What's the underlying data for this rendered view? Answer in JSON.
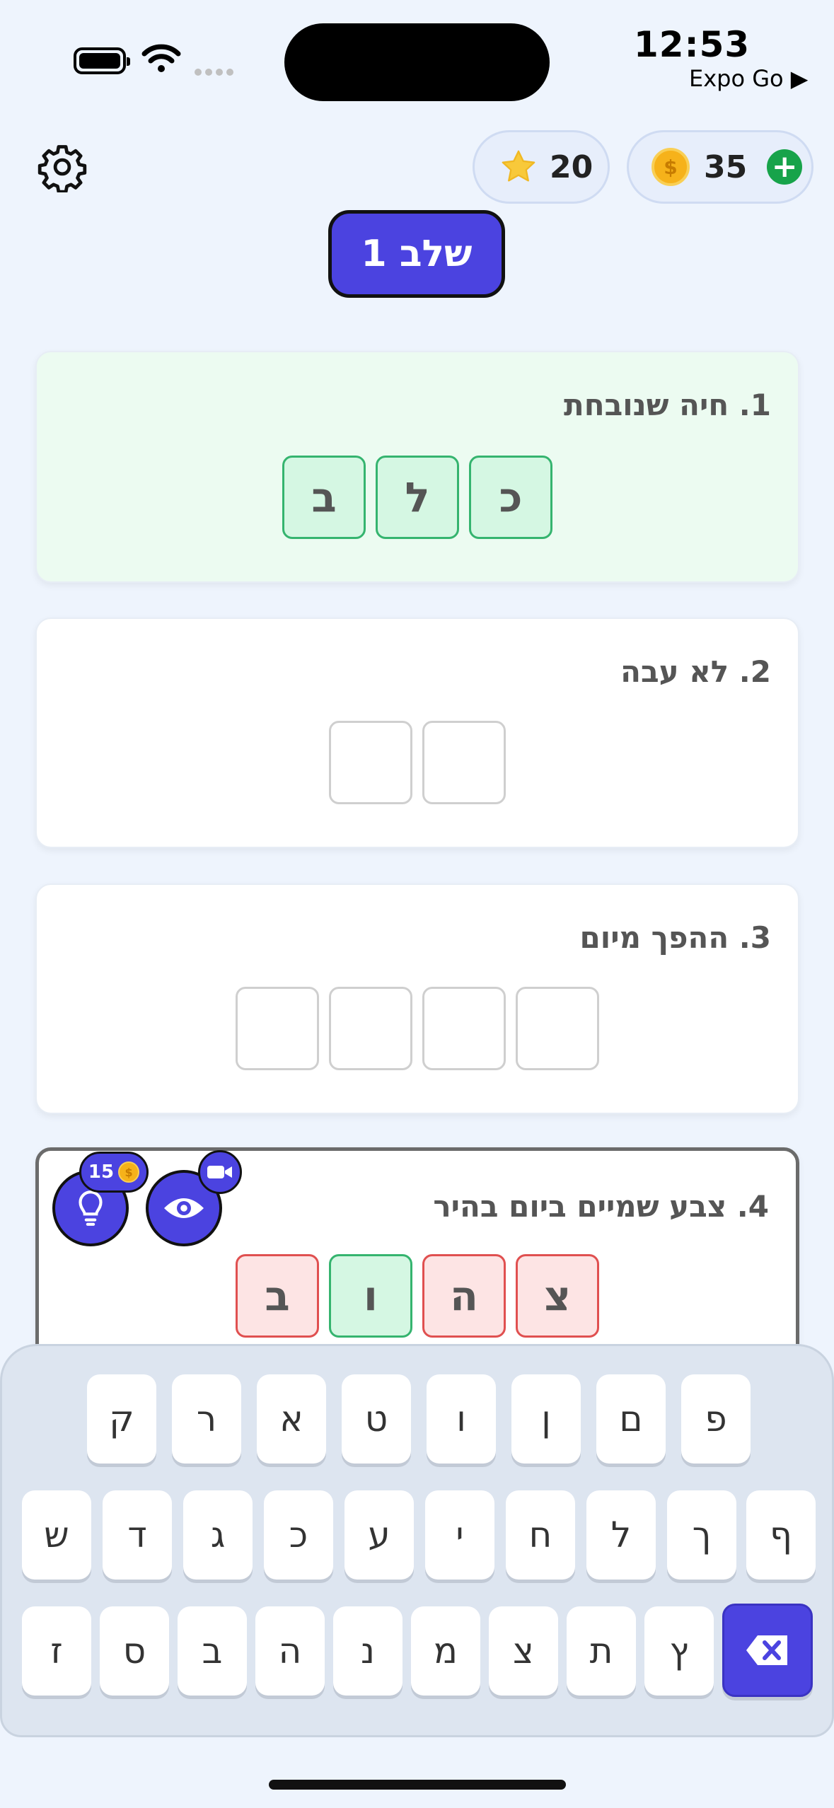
{
  "status": {
    "time": "12:53",
    "carrier_link": "Expo Go ▶"
  },
  "header": {
    "stars": "20",
    "coins": "35",
    "coin_symbol": "$",
    "plus": "+"
  },
  "stage": {
    "label": "שלב 1"
  },
  "puzzles": [
    {
      "clue": "1. חיה שנובחת",
      "state": "solved",
      "letters": [
        {
          "char": "כ",
          "state": "correct"
        },
        {
          "char": "ל",
          "state": "correct"
        },
        {
          "char": "ב",
          "state": "correct"
        }
      ]
    },
    {
      "clue": "2. לא עבה",
      "state": "empty",
      "letters": [
        {
          "char": "",
          "state": "empty"
        },
        {
          "char": "",
          "state": "empty"
        }
      ]
    },
    {
      "clue": "3. ההפך מיום",
      "state": "empty",
      "letters": [
        {
          "char": "",
          "state": "empty"
        },
        {
          "char": "",
          "state": "empty"
        },
        {
          "char": "",
          "state": "empty"
        },
        {
          "char": "",
          "state": "empty"
        }
      ]
    },
    {
      "clue": "4. צבע שמיים ביום בהיר",
      "state": "active",
      "letters": [
        {
          "char": "צ",
          "state": "wrong"
        },
        {
          "char": "ה",
          "state": "wrong"
        },
        {
          "char": "ו",
          "state": "correct"
        },
        {
          "char": "ב",
          "state": "wrong"
        }
      ]
    }
  ],
  "hints": {
    "hint_cost": "15",
    "hint_icon": "lightbulb-icon",
    "reveal_icon": "eye-icon",
    "video_icon": "video-camera-icon"
  },
  "keyboard": {
    "row1": [
      "ק",
      "ר",
      "א",
      "ט",
      "ו",
      "ן",
      "ם",
      "פ"
    ],
    "row2": [
      "ש",
      "ד",
      "ג",
      "כ",
      "ע",
      "י",
      "ח",
      "ל",
      "ך",
      "ף"
    ],
    "row3": [
      "ז",
      "ס",
      "ב",
      "ה",
      "נ",
      "מ",
      "צ",
      "ת",
      "ץ"
    ],
    "delete_icon": "backspace-icon"
  },
  "colors": {
    "accent": "#4b43e0",
    "correct": "#35b46f",
    "wrong": "#e05050",
    "background": "#eef4fd"
  }
}
